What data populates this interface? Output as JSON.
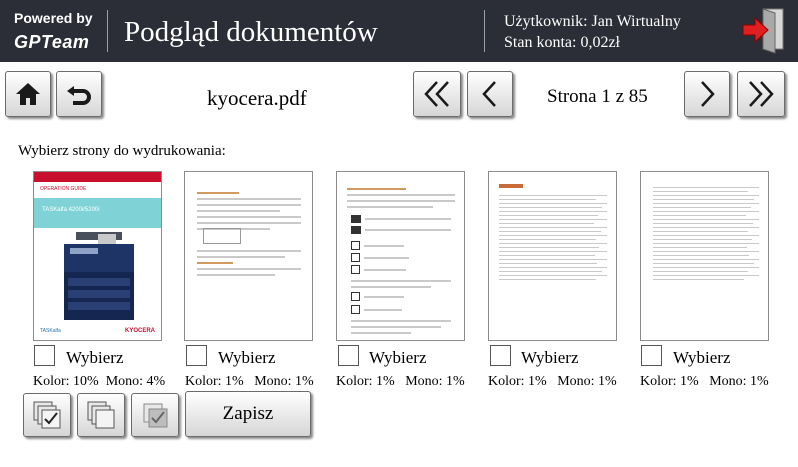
{
  "header": {
    "powered_by": "Powered by",
    "brand": "GPTeam",
    "title": "Podgląd dokumentów",
    "user_line": "Użytkownik: Jan Wirtualny",
    "balance_line": "Stan konta: 0,02zł"
  },
  "toolbar": {
    "filename": "kyocera.pdf",
    "page_indicator": "Strona 1 z 85"
  },
  "instruction": "Wybierz strony do wydrukowania:",
  "pages": [
    {
      "select_label": "Wybierz",
      "stats": "Kolor: 10%  Mono: 4%",
      "selected": false
    },
    {
      "select_label": "Wybierz",
      "stats": "Kolor: 1%   Mono: 1%",
      "selected": false
    },
    {
      "select_label": "Wybierz",
      "stats": "Kolor: 1%   Mono: 1%",
      "selected": false
    },
    {
      "select_label": "Wybierz",
      "stats": "Kolor: 1%   Mono: 1%",
      "selected": false
    },
    {
      "select_label": "Wybierz",
      "stats": "Kolor: 1%   Mono: 1%",
      "selected": false
    }
  ],
  "thumb1": {
    "guide_label": "OPERATION GUIDE",
    "model": "TASKalfa 4200i/5200i",
    "footer_left": "TASKalfa",
    "footer_right": "KYOCERA"
  },
  "bottom": {
    "save_label": "Zapisz"
  }
}
